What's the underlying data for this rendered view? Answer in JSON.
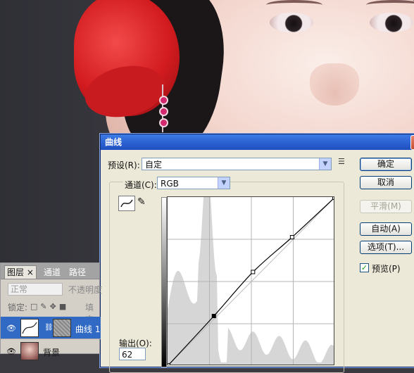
{
  "dialog": {
    "title": "曲线",
    "close_glyph": "X",
    "preset_label": "预设(R):",
    "preset_value": "自定",
    "channel_label": "通道(C):",
    "channel_value": "RGB",
    "output_label": "输出(O):",
    "output_value": "62",
    "buttons": {
      "ok": "确定",
      "cancel": "取消",
      "smooth": "平滑(M)",
      "auto": "自动(A)",
      "options": "选项(T)..."
    },
    "preview_label": "预览(P)",
    "preview_checked": true
  },
  "layers_panel": {
    "tabs": [
      "图层",
      "通道",
      "路径"
    ],
    "tab_close": "×",
    "blend_mode": "正常",
    "opacity_label": "不透明度",
    "lock_label": "锁定:",
    "fill_label": "填充",
    "layers": [
      {
        "name": "曲线 1",
        "selected": true
      },
      {
        "name": "背景",
        "selected": false
      }
    ]
  },
  "chart_data": {
    "type": "line",
    "curve_points": [
      [
        0,
        0
      ],
      [
        70,
        75
      ],
      [
        130,
        142
      ],
      [
        190,
        195
      ],
      [
        255,
        255
      ]
    ],
    "xlim": [
      0,
      255
    ],
    "ylim": [
      0,
      255
    ],
    "grid": true
  }
}
